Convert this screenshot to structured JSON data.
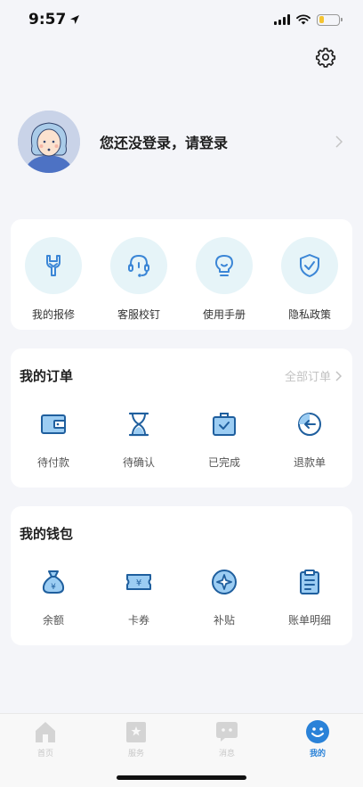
{
  "status_bar": {
    "time": "9:57",
    "battery_level": 0.25
  },
  "profile": {
    "login_prompt": "您还没登录，请登录"
  },
  "services": [
    {
      "label": "我的报修",
      "icon": "wrench-icon"
    },
    {
      "label": "客服校钉",
      "icon": "headset-icon"
    },
    {
      "label": "使用手册",
      "icon": "lightbulb-icon"
    },
    {
      "label": "隐私政策",
      "icon": "shield-check-icon"
    }
  ],
  "orders": {
    "title": "我的订单",
    "all_link": "全部订单",
    "items": [
      {
        "label": "待付款",
        "icon": "wallet-icon"
      },
      {
        "label": "待确认",
        "icon": "hourglass-icon"
      },
      {
        "label": "已完成",
        "icon": "briefcase-check-icon"
      },
      {
        "label": "退款单",
        "icon": "refund-icon"
      }
    ]
  },
  "wallet": {
    "title": "我的钱包",
    "items": [
      {
        "label": "余额",
        "icon": "money-bag-icon"
      },
      {
        "label": "卡券",
        "icon": "ticket-icon"
      },
      {
        "label": "补贴",
        "icon": "compass-icon"
      },
      {
        "label": "账单明细",
        "icon": "clipboard-icon"
      }
    ]
  },
  "tabbar": [
    {
      "label": "首页",
      "icon": "home-icon",
      "active": false
    },
    {
      "label": "服务",
      "icon": "service-icon",
      "active": false
    },
    {
      "label": "消息",
      "icon": "message-icon",
      "active": false
    },
    {
      "label": "我的",
      "icon": "smile-icon",
      "active": true
    }
  ],
  "colors": {
    "accent": "#2a82d8",
    "icon_blue": "#3b86d6",
    "service_bg": "#e6f4f8",
    "background": "#f4f5f9"
  }
}
